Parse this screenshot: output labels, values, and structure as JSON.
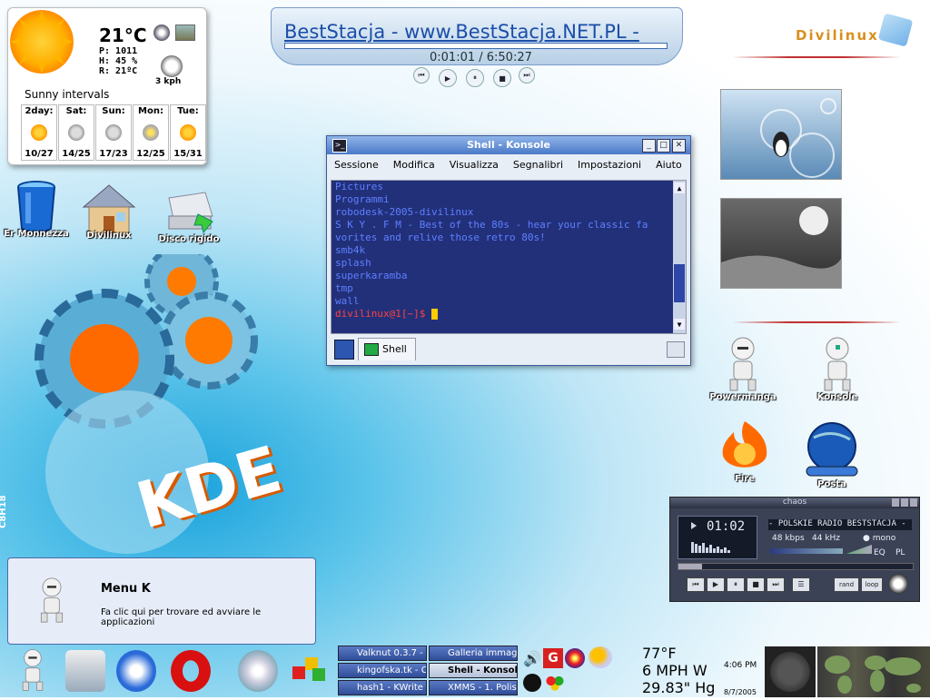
{
  "weather": {
    "temp": "21°C",
    "pressure": "P: 1011",
    "humidity": "H: 45 %",
    "realfeel": "R: 21ºC",
    "wind": "3 kph",
    "summary": "Sunny intervals",
    "forecast": [
      {
        "day": "2day:",
        "temps": "10/27",
        "icon": "sun-icon"
      },
      {
        "day": "Sat:",
        "temps": "14/25",
        "icon": "rain-cloud-icon"
      },
      {
        "day": "Sun:",
        "temps": "17/23",
        "icon": "rain-cloud-icon"
      },
      {
        "day": "Mon:",
        "temps": "12/25",
        "icon": "storm-cloud-icon"
      },
      {
        "day": "Tue:",
        "temps": "15/31",
        "icon": "sun-icon"
      }
    ]
  },
  "top_player": {
    "song": "BestStacja - www.BestStacja.NET.PL -",
    "time": "0:01:01 / 6:50:27"
  },
  "logo": "Divilinux",
  "desktop_icons": {
    "trash": "Er Monnezza",
    "home": "Divilinux",
    "disk": "Disco rigido",
    "powerman": "Powermanga",
    "konsole": "Konsole",
    "fire": "Fire",
    "mail": "Posta"
  },
  "side_text": "C8H18",
  "konsole": {
    "title": "Shell - Konsole",
    "menu": [
      "Sessione",
      "Modifica",
      "Visualizza",
      "Segnalibri",
      "Impostazioni",
      "Aiuto"
    ],
    "lines": [
      "Pictures",
      "Programmi",
      "robodesk-2005-divilinux",
      "S K Y . F M - Best of the 80s - hear your classic fa",
      "vorites and relive those retro 80s!",
      "smb4k",
      "splash",
      "superkaramba",
      "tmp",
      "wall"
    ],
    "prompt": "divilinux@1[~]$ ",
    "tab": "Shell"
  },
  "xmms": {
    "title": "chaos",
    "time": "01:02",
    "song": "- POLSKIE RADIO BESTSTACJA - 1",
    "kbps": "48",
    "kbps_unit": "kbps",
    "khz": "44",
    "khz_unit": "kHz",
    "mode": "mono",
    "eq": "EQ",
    "pl": "PL",
    "rand": "rand",
    "loop": "loop"
  },
  "menuk": {
    "title": "Menu K",
    "desc": "Fa clic qui per trovare ed avviare le applicazioni"
  },
  "taskbar": [
    {
      "label": "Valknut 0.3.7 -",
      "active": false
    },
    {
      "label": "kingofska.tk - C",
      "active": false
    },
    {
      "label": "hash1 - KWrite",
      "active": false
    },
    {
      "label": "Galleria immag",
      "active": false
    },
    {
      "label": "Shell - Konsole",
      "active": true
    },
    {
      "label": "XMMS - 1. Polis",
      "active": false
    }
  ],
  "panel_weather": {
    "temp": "77°F",
    "wind": "6 MPH W",
    "pressure": "29.83\" Hg"
  },
  "clock": {
    "time": "4:06 PM",
    "date": "8/7/2005"
  }
}
